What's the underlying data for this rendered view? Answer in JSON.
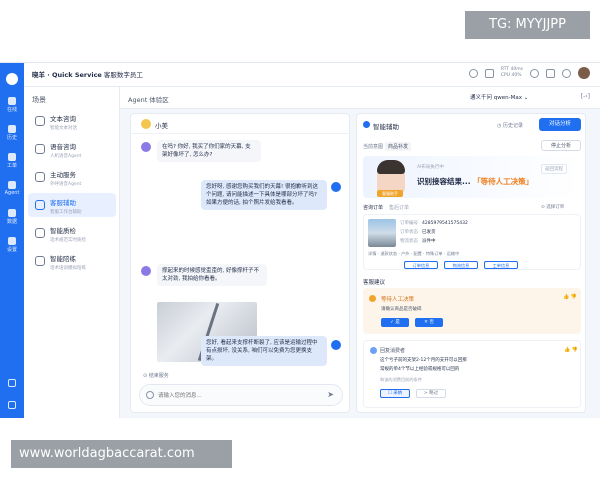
{
  "watermark": {
    "top": "TG: MYYJJPP",
    "bottom": "www.worldagbaccarat.com"
  },
  "brand": {
    "name": "晓羊 · Quick Service",
    "subtitle": "客服数字员工"
  },
  "topbar": {
    "stat1": "RTT 40ms",
    "stat2": "CPU 40%"
  },
  "rail": {
    "items": [
      {
        "label": "在线",
        "icon": "chat-icon"
      },
      {
        "label": "历史",
        "icon": "phone-icon"
      },
      {
        "label": "工单",
        "icon": "document-icon"
      },
      {
        "label": "Agent",
        "icon": "robot-icon"
      },
      {
        "label": "数据",
        "icon": "chart-icon"
      },
      {
        "label": "设置",
        "icon": "gear-icon"
      }
    ]
  },
  "nav": {
    "title": "场景",
    "items": [
      {
        "label": "文本咨询",
        "sub": "智能文本对话",
        "icon": "text-chat-icon"
      },
      {
        "label": "语音咨询",
        "sub": "人机语音Agent",
        "icon": "voice-icon"
      },
      {
        "label": "主动服务",
        "sub": "外呼语音Agent",
        "icon": "outbound-icon"
      },
      {
        "label": "客服辅助",
        "sub": "客服工作台辅助",
        "icon": "assist-icon"
      },
      {
        "label": "智能质检",
        "sub": "话术规范实时质检",
        "icon": "quality-icon"
      },
      {
        "label": "智能陪练",
        "sub": "话术培训模拟陪练",
        "icon": "training-icon"
      }
    ]
  },
  "panel": {
    "title": "Agent 体验区",
    "model": "通义千问 qwen-Max ⌄",
    "collapse": "[-›]"
  },
  "chat": {
    "customer_name": "小美",
    "messages": [
      {
        "role": "customer",
        "text": "在吗? 你好, 我买了你们家的天幕, 支架好像坏了, 怎么办?"
      },
      {
        "role": "agent",
        "text": "您好呀, 感谢您购买我们的天幕! 很抱歉听到这个问题, 请问能描述一下具体是哪部分坏了吗? 如果方便的话, 拍个照片发给我看看。"
      },
      {
        "role": "customer",
        "text": "撑起来的时候感觉歪歪的, 好像撑杆子不太对劲, 我拍给你看看。"
      },
      {
        "role": "agent",
        "text": "您好, 看起来支撑杆断裂了, 应该是运输过程中有点损坏, 没关系, 咱们可以免费为您更换支架。"
      }
    ],
    "end_service": "⊙ 结束服务",
    "input_placeholder": "请输入您的消息..."
  },
  "assist": {
    "title": "智能辅助",
    "history": "◷ 历史记录",
    "analyze": "对话分析",
    "tag_label": "当前意图",
    "tag_value": "商品补发",
    "stop": "停止分析",
    "status_sub": "AI布局执行中",
    "status_main_pre": "识别接容结果... ",
    "status_main_hl": "「等待人工决策」",
    "status_badge": "返回流程",
    "robot_tag": "客服助手",
    "order_tab1": "咨询订单",
    "order_tab2": "售后订单",
    "order_more": "⊙ 选择订单",
    "order": {
      "no_label": "订单编号",
      "no": "4285979541575432",
      "status_label": "订单状态",
      "status": "已发货",
      "ship_label": "物流状态",
      "ship": "派件中",
      "detail": "详情 · 退款状态 · 户外 · 配置 · 特殊订单 · 运输中",
      "buttons": [
        "订单信息",
        "物流信息",
        "工单信息"
      ]
    },
    "suggest_title": "客服建议",
    "suggest": {
      "head": "等待人工决策",
      "text": "请确认商品是否破碎",
      "yes": "✓ 是",
      "no": "✕ 否",
      "thumbs": "👍 👎"
    },
    "suggest2": {
      "head": "回复消费者",
      "line1": "这个亏子前的支架2-12个月的支开可以回那",
      "line2": "常规的单4个节以上经验或规格可以回的",
      "note": "和该的消费目前的条件",
      "adopt": "☐ 采纳",
      "skip": "> 略过"
    }
  }
}
